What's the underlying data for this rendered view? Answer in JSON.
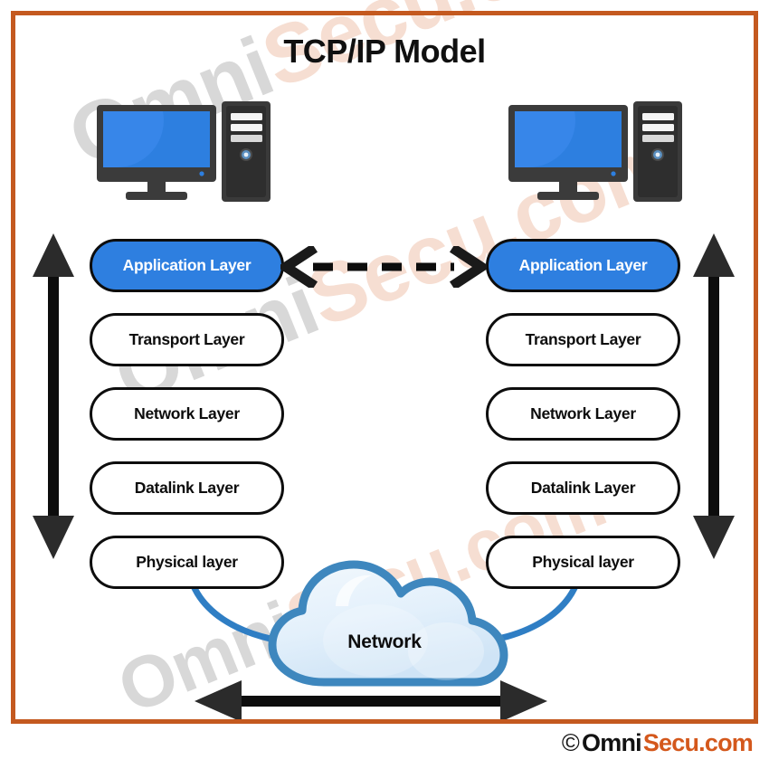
{
  "page": {
    "title": "TCP/IP Model",
    "border_color": "#c4591f",
    "background": "#ffffff"
  },
  "colors": {
    "accent_blue": "#2e7fe0",
    "border_orange": "#c4591f",
    "outline_black": "#0d0d0d",
    "cloud_outline": "#3e87be",
    "cloud_fill": "#e8f2fb",
    "footer_accent": "#d4581c",
    "watermark_gray": "#d8d8d8",
    "watermark_peach": "#f6ded2"
  },
  "hosts": {
    "left": {
      "icon": "desktop-computer-icon",
      "label": ""
    },
    "right": {
      "icon": "desktop-computer-icon",
      "label": ""
    }
  },
  "stacks": {
    "left": {
      "name": "left-tcpip-stack",
      "layers": [
        {
          "label": "Application Layer",
          "highlighted": true
        },
        {
          "label": "Transport Layer",
          "highlighted": false
        },
        {
          "label": "Network Layer",
          "highlighted": false
        },
        {
          "label": "Datalink Layer",
          "highlighted": false
        },
        {
          "label": "Physical layer",
          "highlighted": false
        }
      ]
    },
    "right": {
      "name": "right-tcpip-stack",
      "layers": [
        {
          "label": "Application Layer",
          "highlighted": true
        },
        {
          "label": "Transport Layer",
          "highlighted": false
        },
        {
          "label": "Network Layer",
          "highlighted": false
        },
        {
          "label": "Datalink Layer",
          "highlighted": false
        },
        {
          "label": "Physical layer",
          "highlighted": false
        }
      ]
    }
  },
  "cloud": {
    "label": "Network",
    "icon": "network-cloud-icon"
  },
  "connectors": {
    "app_peer_arrow": {
      "icon": "dashed-double-arrow-icon",
      "style": "dashed",
      "direction": "bidirectional"
    },
    "left_stack_arrow": {
      "icon": "vertical-double-arrow-icon",
      "direction": "bidirectional"
    },
    "right_stack_arrow": {
      "icon": "vertical-double-arrow-icon",
      "direction": "bidirectional"
    },
    "network_span_arrow": {
      "icon": "horizontal-double-arrow-icon",
      "direction": "bidirectional"
    },
    "left_media_link": {
      "icon": "curved-link-icon"
    },
    "right_media_link": {
      "icon": "curved-link-icon"
    }
  },
  "watermark": {
    "part_one": "Omni",
    "part_two": "Secu.com"
  },
  "footer": {
    "copyright_symbol": "©",
    "brand_first": "Omni",
    "brand_second": "Secu.com"
  }
}
